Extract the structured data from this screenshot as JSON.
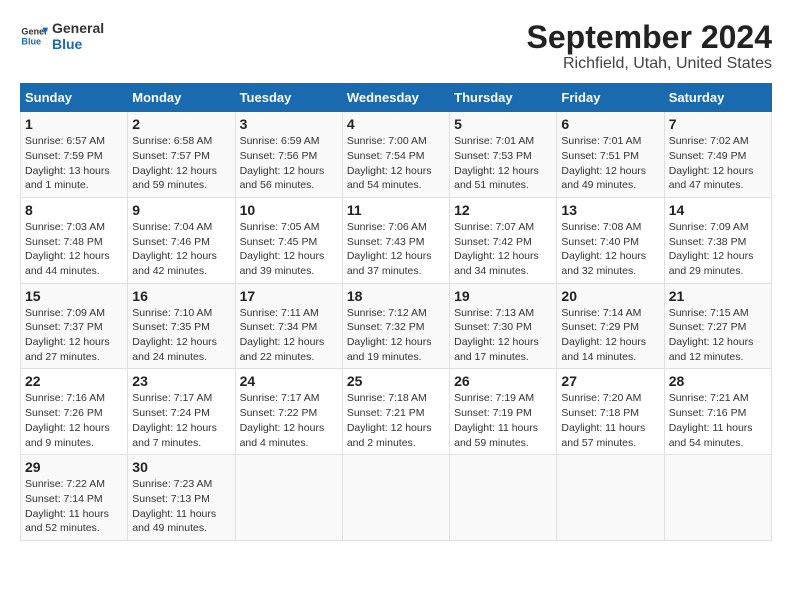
{
  "header": {
    "logo_line1": "General",
    "logo_line2": "Blue",
    "title": "September 2024",
    "subtitle": "Richfield, Utah, United States"
  },
  "weekdays": [
    "Sunday",
    "Monday",
    "Tuesday",
    "Wednesday",
    "Thursday",
    "Friday",
    "Saturday"
  ],
  "weeks": [
    [
      {
        "day": "1",
        "info": "Sunrise: 6:57 AM\nSunset: 7:59 PM\nDaylight: 13 hours\nand 1 minute."
      },
      {
        "day": "2",
        "info": "Sunrise: 6:58 AM\nSunset: 7:57 PM\nDaylight: 12 hours\nand 59 minutes."
      },
      {
        "day": "3",
        "info": "Sunrise: 6:59 AM\nSunset: 7:56 PM\nDaylight: 12 hours\nand 56 minutes."
      },
      {
        "day": "4",
        "info": "Sunrise: 7:00 AM\nSunset: 7:54 PM\nDaylight: 12 hours\nand 54 minutes."
      },
      {
        "day": "5",
        "info": "Sunrise: 7:01 AM\nSunset: 7:53 PM\nDaylight: 12 hours\nand 51 minutes."
      },
      {
        "day": "6",
        "info": "Sunrise: 7:01 AM\nSunset: 7:51 PM\nDaylight: 12 hours\nand 49 minutes."
      },
      {
        "day": "7",
        "info": "Sunrise: 7:02 AM\nSunset: 7:49 PM\nDaylight: 12 hours\nand 47 minutes."
      }
    ],
    [
      {
        "day": "8",
        "info": "Sunrise: 7:03 AM\nSunset: 7:48 PM\nDaylight: 12 hours\nand 44 minutes."
      },
      {
        "day": "9",
        "info": "Sunrise: 7:04 AM\nSunset: 7:46 PM\nDaylight: 12 hours\nand 42 minutes."
      },
      {
        "day": "10",
        "info": "Sunrise: 7:05 AM\nSunset: 7:45 PM\nDaylight: 12 hours\nand 39 minutes."
      },
      {
        "day": "11",
        "info": "Sunrise: 7:06 AM\nSunset: 7:43 PM\nDaylight: 12 hours\nand 37 minutes."
      },
      {
        "day": "12",
        "info": "Sunrise: 7:07 AM\nSunset: 7:42 PM\nDaylight: 12 hours\nand 34 minutes."
      },
      {
        "day": "13",
        "info": "Sunrise: 7:08 AM\nSunset: 7:40 PM\nDaylight: 12 hours\nand 32 minutes."
      },
      {
        "day": "14",
        "info": "Sunrise: 7:09 AM\nSunset: 7:38 PM\nDaylight: 12 hours\nand 29 minutes."
      }
    ],
    [
      {
        "day": "15",
        "info": "Sunrise: 7:09 AM\nSunset: 7:37 PM\nDaylight: 12 hours\nand 27 minutes."
      },
      {
        "day": "16",
        "info": "Sunrise: 7:10 AM\nSunset: 7:35 PM\nDaylight: 12 hours\nand 24 minutes."
      },
      {
        "day": "17",
        "info": "Sunrise: 7:11 AM\nSunset: 7:34 PM\nDaylight: 12 hours\nand 22 minutes."
      },
      {
        "day": "18",
        "info": "Sunrise: 7:12 AM\nSunset: 7:32 PM\nDaylight: 12 hours\nand 19 minutes."
      },
      {
        "day": "19",
        "info": "Sunrise: 7:13 AM\nSunset: 7:30 PM\nDaylight: 12 hours\nand 17 minutes."
      },
      {
        "day": "20",
        "info": "Sunrise: 7:14 AM\nSunset: 7:29 PM\nDaylight: 12 hours\nand 14 minutes."
      },
      {
        "day": "21",
        "info": "Sunrise: 7:15 AM\nSunset: 7:27 PM\nDaylight: 12 hours\nand 12 minutes."
      }
    ],
    [
      {
        "day": "22",
        "info": "Sunrise: 7:16 AM\nSunset: 7:26 PM\nDaylight: 12 hours\nand 9 minutes."
      },
      {
        "day": "23",
        "info": "Sunrise: 7:17 AM\nSunset: 7:24 PM\nDaylight: 12 hours\nand 7 minutes."
      },
      {
        "day": "24",
        "info": "Sunrise: 7:17 AM\nSunset: 7:22 PM\nDaylight: 12 hours\nand 4 minutes."
      },
      {
        "day": "25",
        "info": "Sunrise: 7:18 AM\nSunset: 7:21 PM\nDaylight: 12 hours\nand 2 minutes."
      },
      {
        "day": "26",
        "info": "Sunrise: 7:19 AM\nSunset: 7:19 PM\nDaylight: 11 hours\nand 59 minutes."
      },
      {
        "day": "27",
        "info": "Sunrise: 7:20 AM\nSunset: 7:18 PM\nDaylight: 11 hours\nand 57 minutes."
      },
      {
        "day": "28",
        "info": "Sunrise: 7:21 AM\nSunset: 7:16 PM\nDaylight: 11 hours\nand 54 minutes."
      }
    ],
    [
      {
        "day": "29",
        "info": "Sunrise: 7:22 AM\nSunset: 7:14 PM\nDaylight: 11 hours\nand 52 minutes."
      },
      {
        "day": "30",
        "info": "Sunrise: 7:23 AM\nSunset: 7:13 PM\nDaylight: 11 hours\nand 49 minutes."
      },
      null,
      null,
      null,
      null,
      null
    ]
  ]
}
